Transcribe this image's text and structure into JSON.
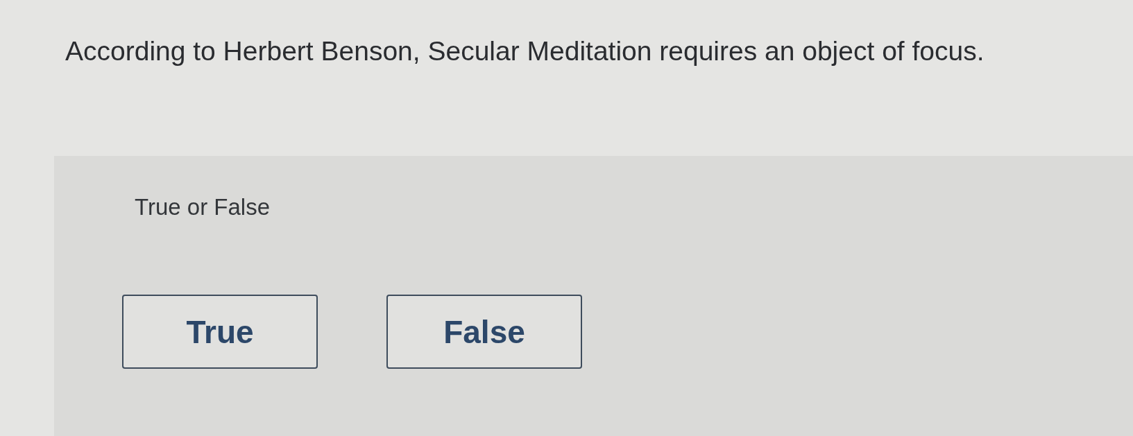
{
  "question": {
    "text": "According to Herbert Benson, Secular Meditation requires an object of focus."
  },
  "answer_panel": {
    "prompt": "True or False",
    "options": [
      {
        "label": "True",
        "selected": false
      },
      {
        "label": "False",
        "selected": false
      }
    ]
  }
}
